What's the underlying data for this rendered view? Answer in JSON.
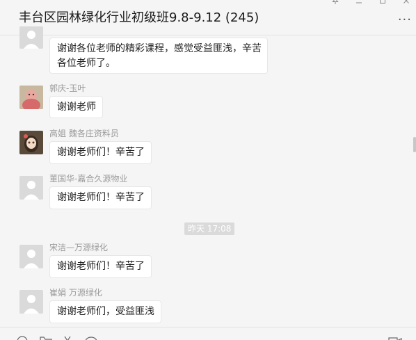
{
  "window": {
    "title": "丰台区园林绿化行业初级班9.8-9.12 (245)",
    "more_label": "···"
  },
  "messages": [
    {
      "sender": "",
      "avatar": "default-avatar-icon",
      "text_lines": [
        "谢谢各位老师的精彩课程，感觉受益匪浅，辛苦",
        "各位老师了。"
      ]
    },
    {
      "sender": "郭庆-玉叶",
      "avatar": "photo-avatar",
      "text": "谢谢老师"
    },
    {
      "sender": "高姐 魏各庄资料员",
      "avatar": "anime-avatar",
      "text": "谢谢老师们！辛苦了"
    },
    {
      "sender": "董国华-嘉合久源物业",
      "avatar": "default-avatar-icon",
      "text": "谢谢老师们！辛苦了"
    },
    {
      "sender": "宋洁—万源绿化",
      "avatar": "default-avatar-icon",
      "text": "谢谢老师们！辛苦了"
    },
    {
      "sender": "崔娟 万源绿化",
      "avatar": "default-avatar-icon",
      "text": "谢谢老师们，受益匪浅"
    }
  ],
  "timestamp": "昨天 17:08",
  "toolbar": {
    "icons": [
      "emoji-icon",
      "folder-icon",
      "scissors-icon",
      "chat-history-icon",
      "video-call-icon"
    ]
  }
}
